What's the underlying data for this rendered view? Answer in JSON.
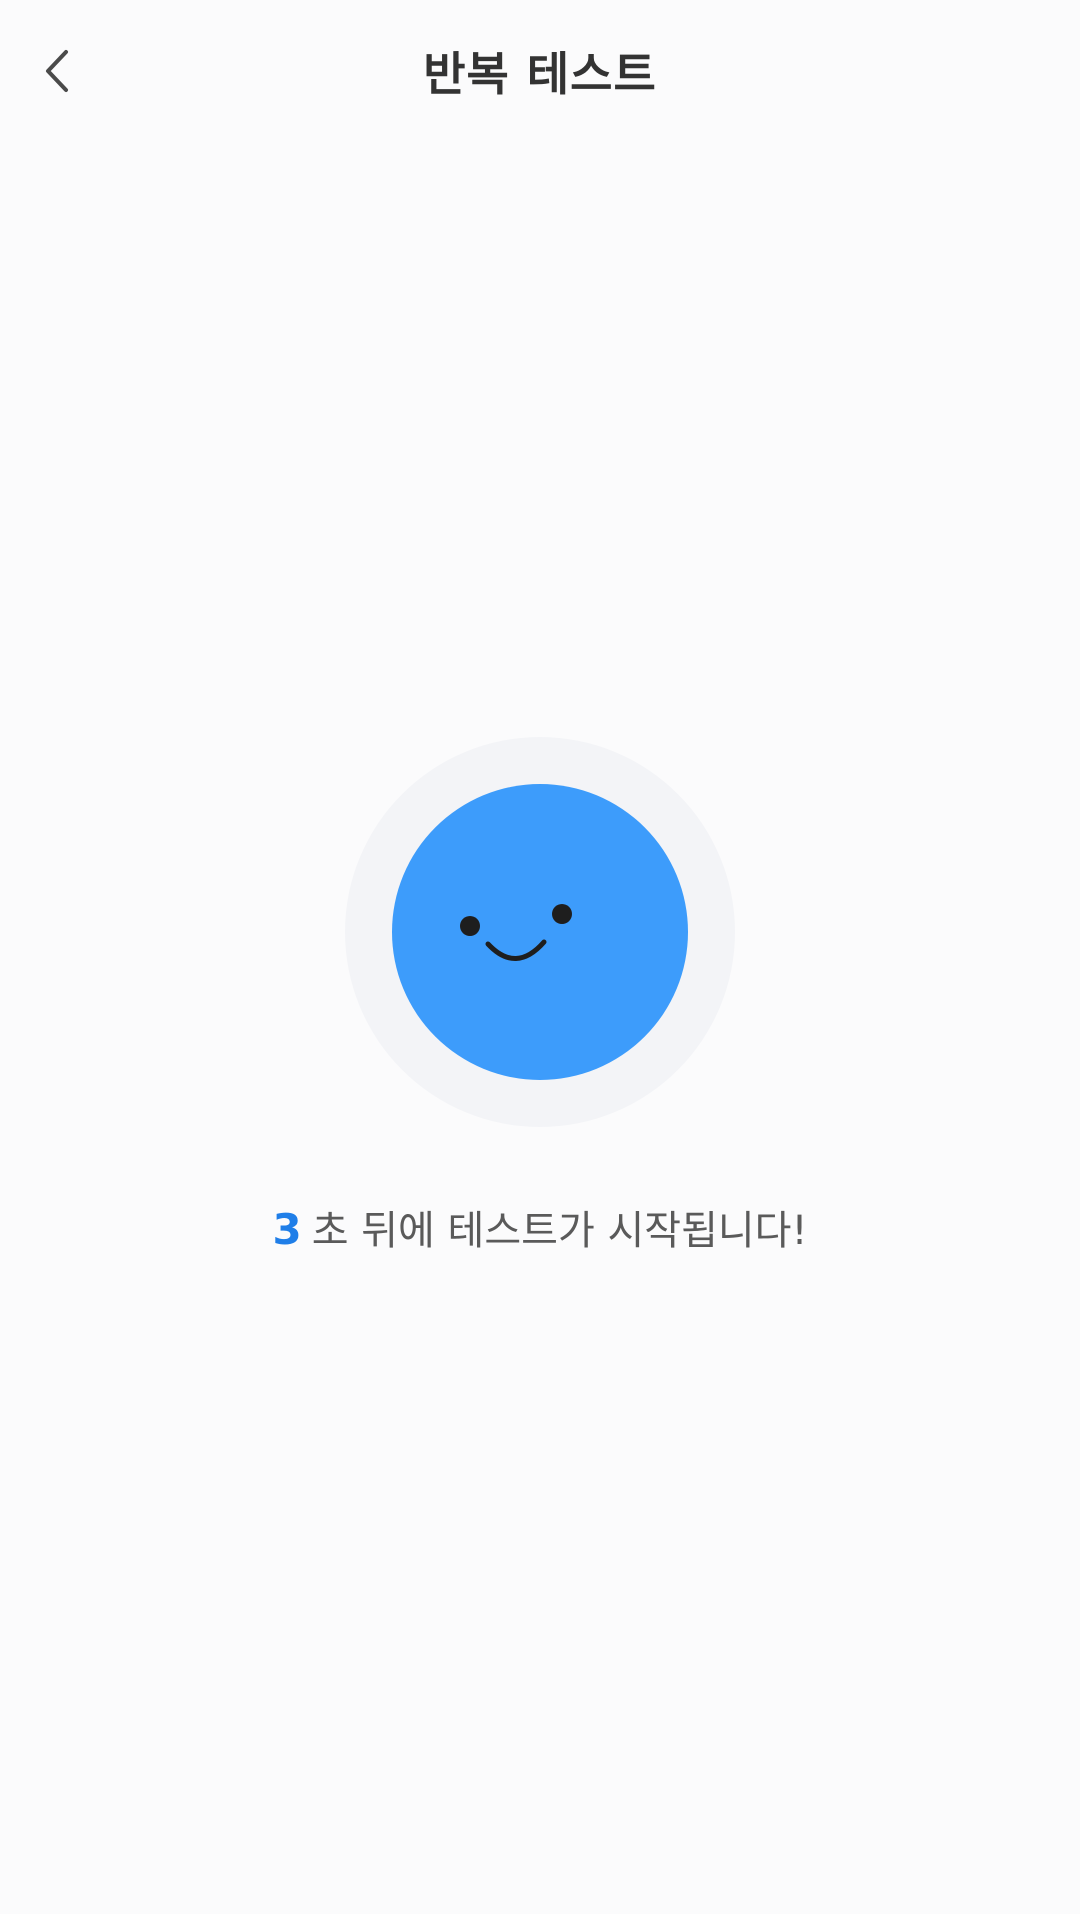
{
  "header": {
    "title": "반복 테스트",
    "back_icon": "chevron-left-icon"
  },
  "avatar": {
    "icon": "smiley-face-icon",
    "face_color": "#3d9cfb",
    "ring_color": "#f3f4f7"
  },
  "countdown": {
    "number": "3",
    "message": "초 뒤에 테스트가 시작됩니다!",
    "number_color": "#1f7ee8"
  }
}
